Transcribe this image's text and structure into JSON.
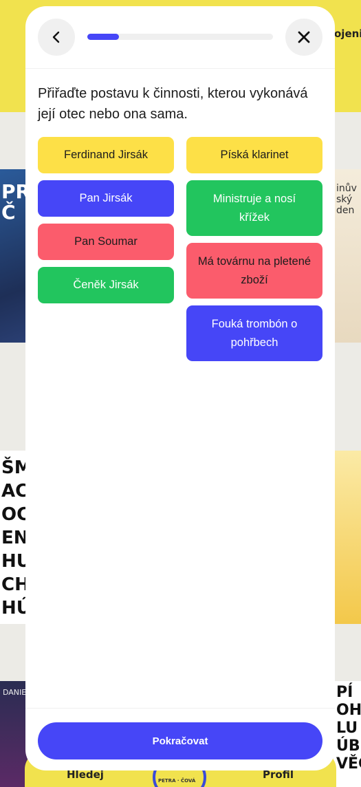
{
  "background": {
    "topbar_text": "ojeni",
    "cover1_text": "PRA Č",
    "cover1_right_text": "inův ský den",
    "cover2_text": "ŠM ACI OCÍ ENI HUF CHI HÚ",
    "cover3_text": "DANIEL",
    "cover3_right_text": "PÍ OHO LU ÚBU VĚCH",
    "nav": {
      "left_label": "Hledej",
      "right_label": "Profil",
      "logo_text": "PETRA · ČOVÁ"
    }
  },
  "modal": {
    "header": {
      "back_icon": "chevron-left-icon",
      "close_icon": "close-icon",
      "progress": 0.17,
      "accent_color": "#4646f7"
    },
    "prompt": "Přiřaďte postavu k činnosti, kterou vykonává její otec nebo ona sama.",
    "left_items": [
      {
        "label": "Ferdinand Jirsák",
        "color": "yellow"
      },
      {
        "label": "Pan Jirsák",
        "color": "blue"
      },
      {
        "label": "Pan Soumar",
        "color": "red"
      },
      {
        "label": "Čeněk Jirsák",
        "color": "green"
      }
    ],
    "right_items": [
      {
        "label": "Píská klarinet",
        "color": "yellow"
      },
      {
        "label": "Ministruje a nosí křížek",
        "color": "green"
      },
      {
        "label": "Má továrnu na pletené zboží",
        "color": "red"
      },
      {
        "label": "Fouká trombón o pohřbech",
        "color": "blue"
      }
    ],
    "colors": {
      "yellow": "#fde047",
      "blue": "#4646f7",
      "red": "#fb5c6c",
      "green": "#22c55e"
    },
    "footer": {
      "continue_label": "Pokračovat"
    }
  }
}
